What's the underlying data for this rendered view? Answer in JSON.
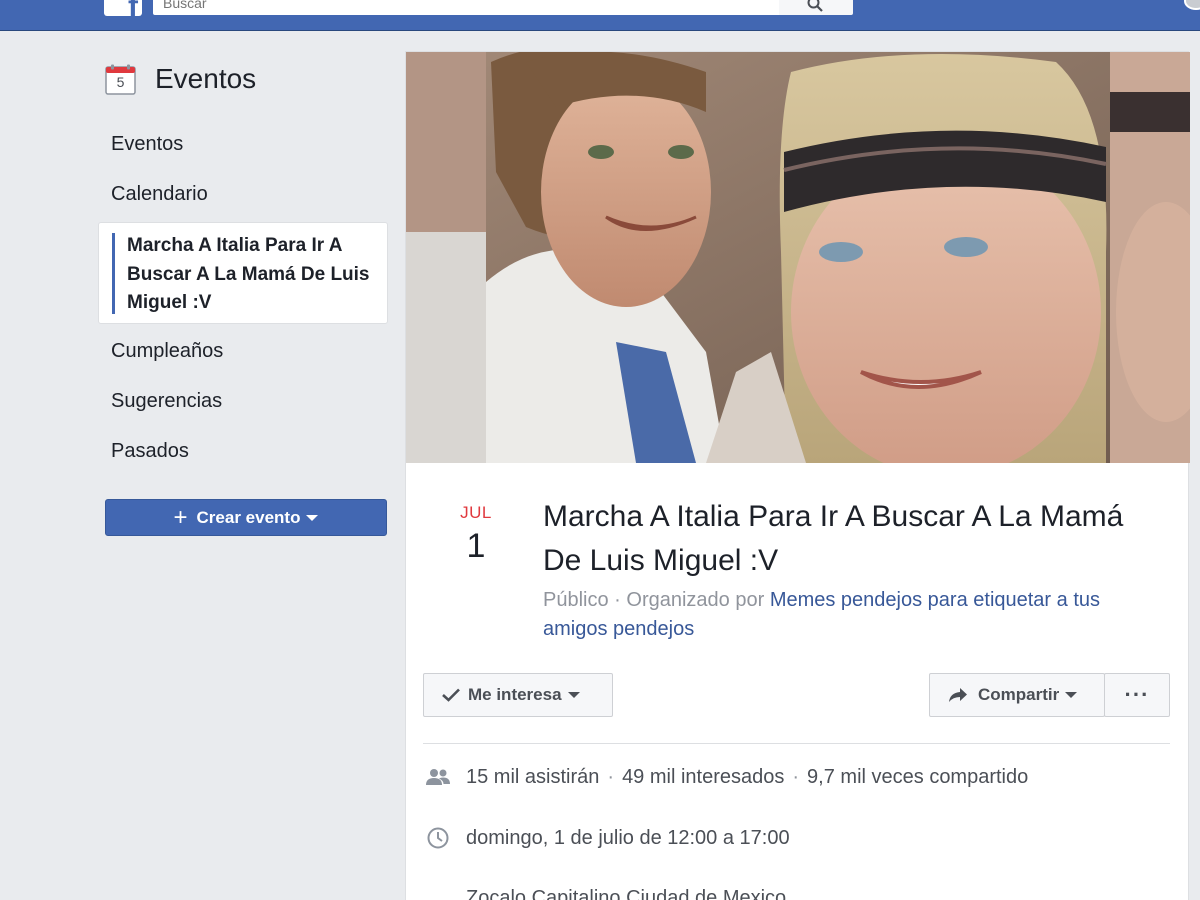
{
  "topbar": {
    "logo": "f",
    "search_placeholder": "Buscar"
  },
  "sidebar": {
    "title": "Eventos",
    "calendar_day": "5",
    "items": [
      {
        "label": "Eventos"
      },
      {
        "label": "Calendario"
      },
      {
        "label": "Marcha A Italia Para Ir A Buscar A La Mamá De Luis Miguel :V",
        "active": true
      },
      {
        "label": "Cumpleaños"
      },
      {
        "label": "Sugerencias"
      },
      {
        "label": "Pasados"
      }
    ],
    "create_button": "Crear evento"
  },
  "event": {
    "month": "JUL",
    "day": "1",
    "title": "Marcha A Italia Para Ir A Buscar A La Mamá De Luis Miguel :V",
    "visibility": "Público",
    "organized_by_prefix": "· Organizado por",
    "organizer": "Memes pendejos para etiquetar a tus amigos pendejos",
    "interest_button": "Me interesa",
    "share_button": "Compartir",
    "more_button": "···",
    "stats": {
      "going": "15 mil asistirán",
      "interested": "49 mil interesados",
      "shared": "9,7 mil veces compartido"
    },
    "datetime": "domingo, 1 de julio de 12:00 a 17:00",
    "location": "Zocalo Capitalino Ciudad de Mexico"
  },
  "colors": {
    "brand": "#4267b2",
    "month": "#e0393e",
    "link": "#385898"
  }
}
